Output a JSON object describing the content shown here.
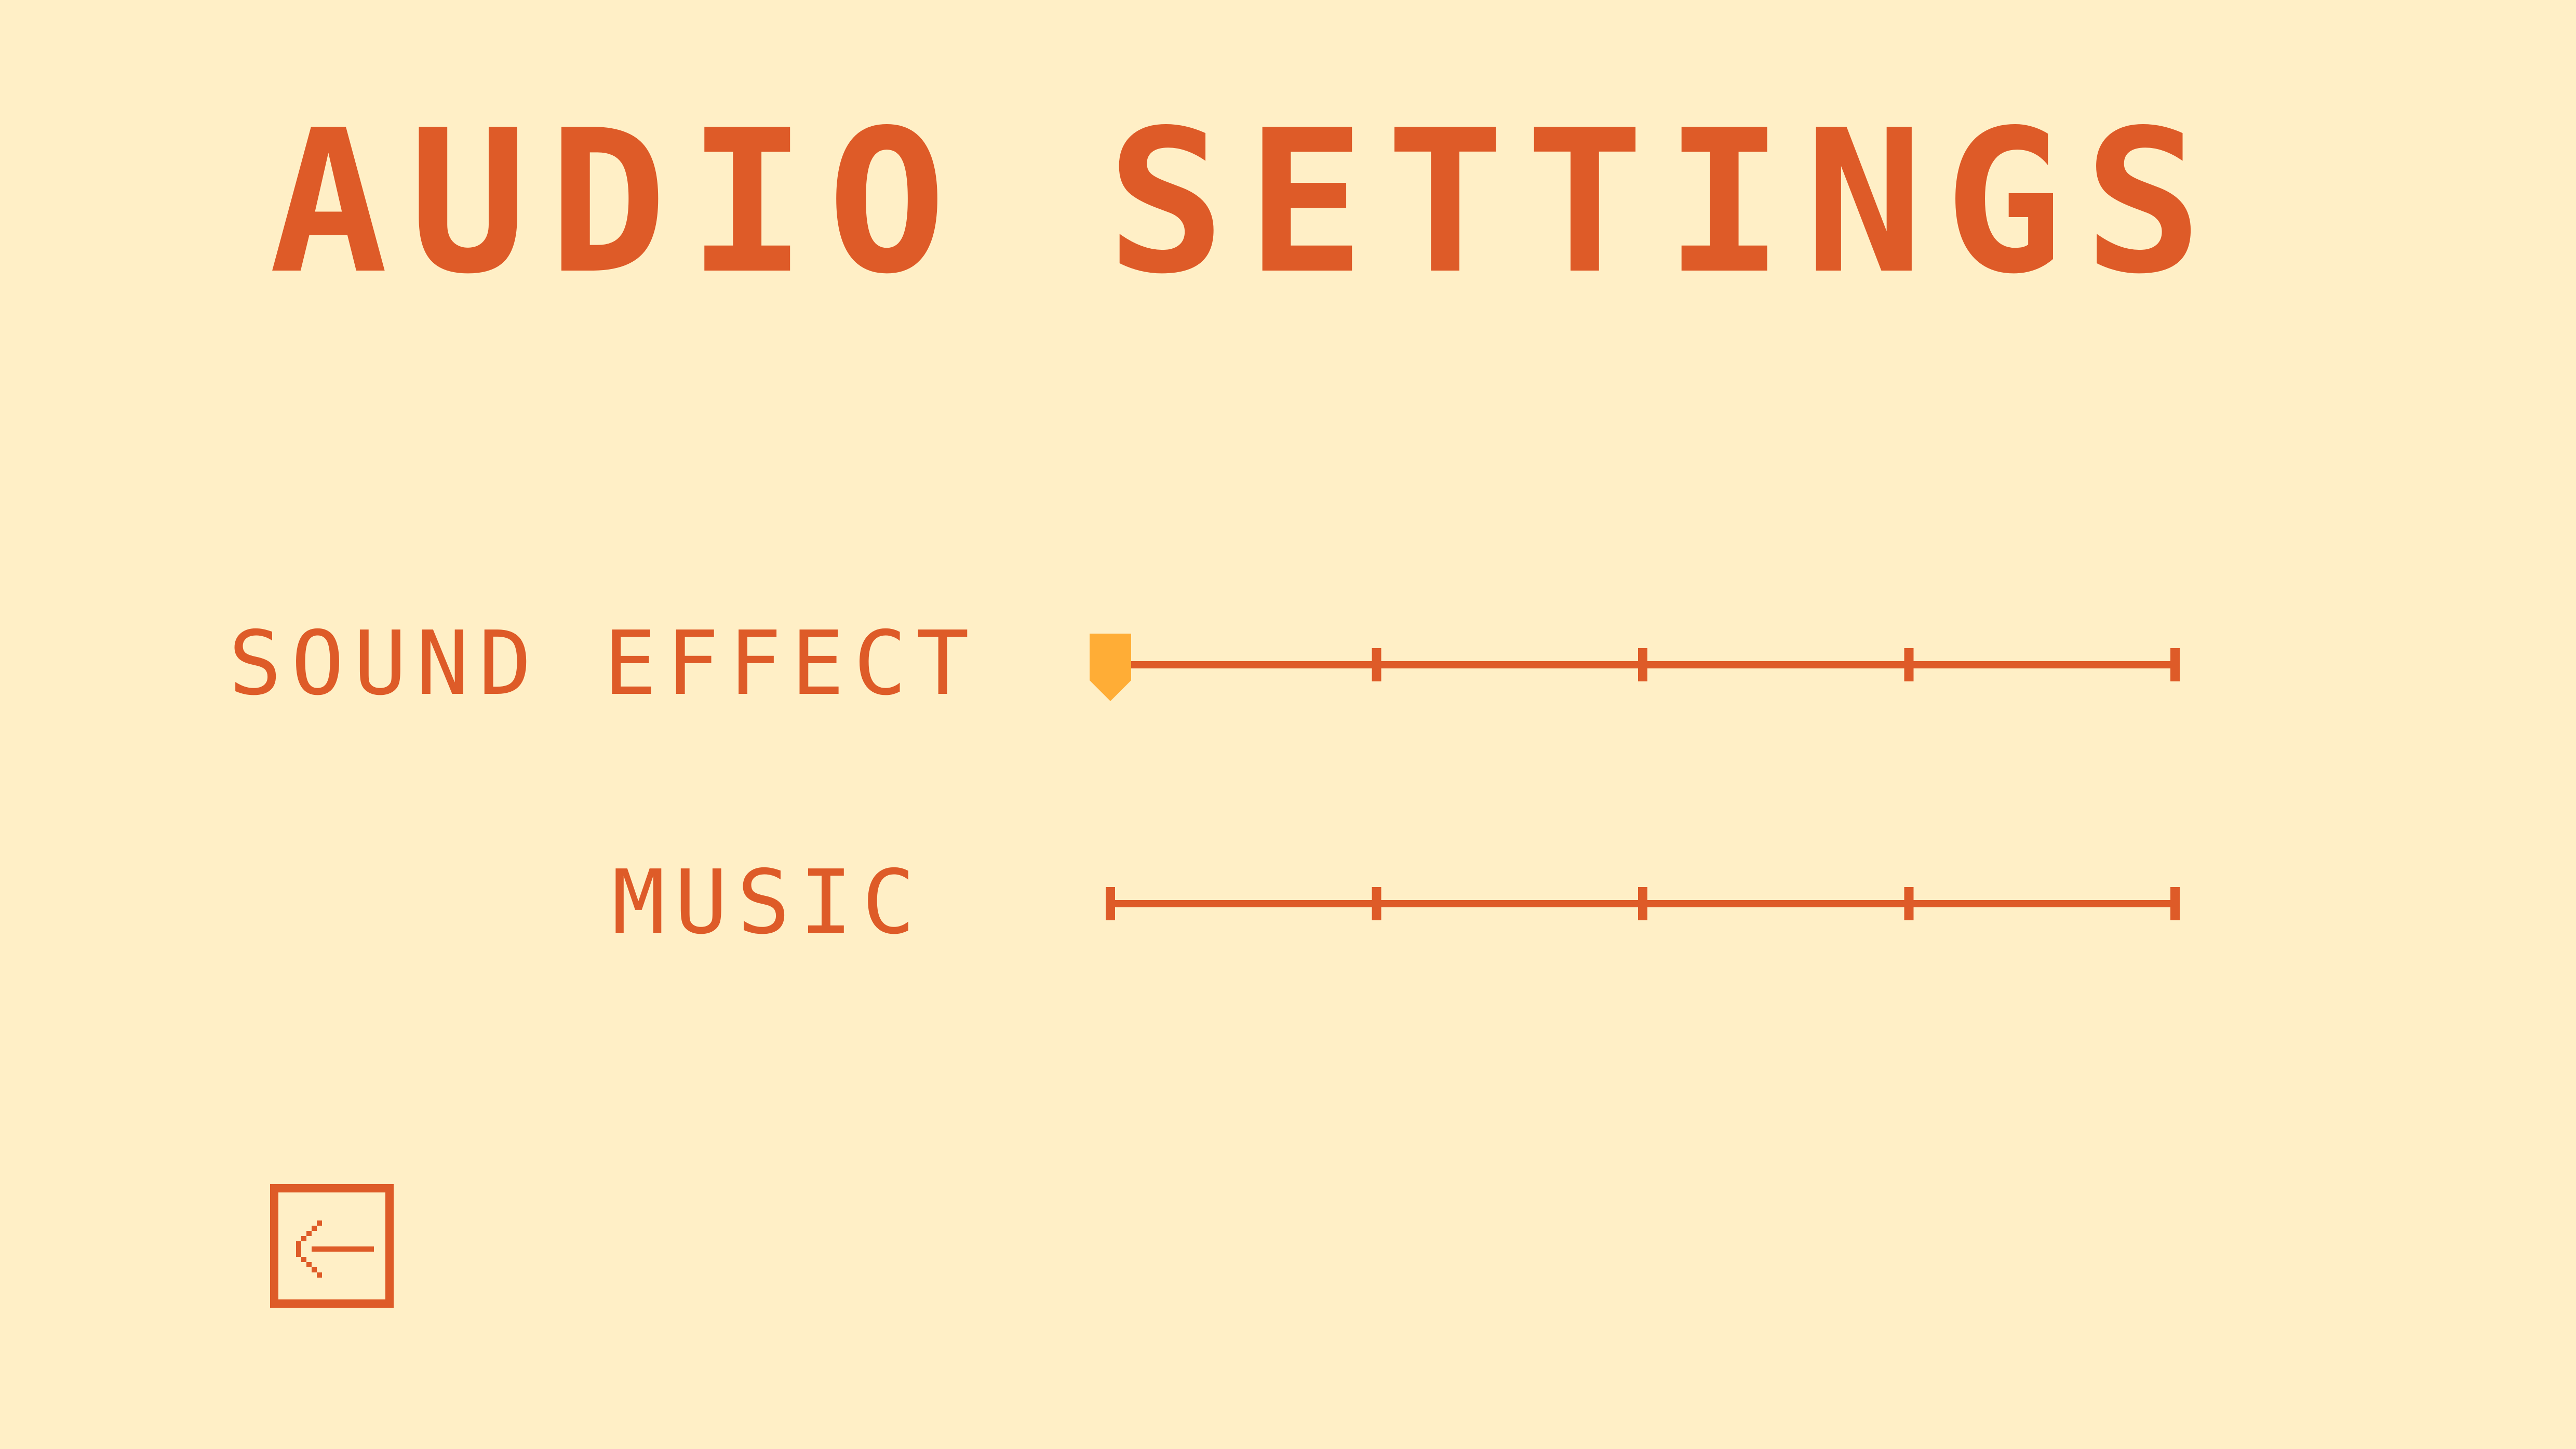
{
  "screen": {
    "title": "AUDIO SETTINGS"
  },
  "settings": [
    {
      "id": "sfx",
      "label": "SOUND EFFECT",
      "level": 0.0,
      "steps": 4
    },
    {
      "id": "music",
      "label": "MUSIC",
      "level": null,
      "steps": 4
    }
  ],
  "back_button": {
    "icon": "arrow-left-icon"
  },
  "colors": {
    "background": "#FFEFC6",
    "accent": "#DE5B28",
    "knob": "#FFAD36"
  }
}
